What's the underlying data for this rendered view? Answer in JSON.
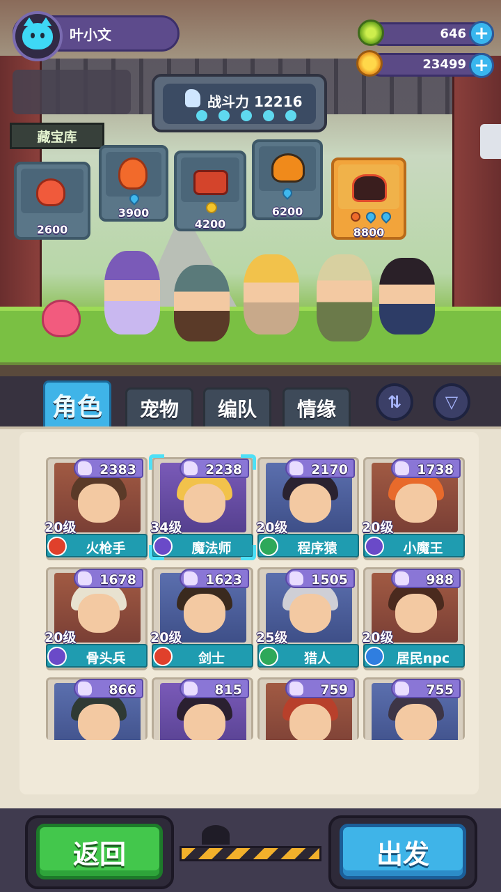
{
  "player": {
    "name": "叶小文"
  },
  "resources": [
    {
      "icon": "green-gem-icon",
      "value": "646"
    },
    {
      "icon": "gold-coin-planet-icon",
      "value": "23499"
    }
  ],
  "power": {
    "label": "战斗力 12216",
    "stars": 5
  },
  "treasure": {
    "label": "藏宝库"
  },
  "pets": [
    {
      "icon": "red-slime-pet",
      "price": "2600",
      "currency": "none"
    },
    {
      "icon": "fire-spirit-pet",
      "price": "3900",
      "currency": "water-drop-icon"
    },
    {
      "icon": "lava-block-pet",
      "price": "4200",
      "currency": "gold-coin-icon"
    },
    {
      "icon": "flame-ghost-pet",
      "price": "6200",
      "currency": "water-drop-icon"
    },
    {
      "icon": "magma-beast-pet",
      "price": "8800",
      "currency": "fire-and-water-icons"
    }
  ],
  "tabs": [
    "角色",
    "宠物",
    "编队",
    "情缘"
  ],
  "active_tab": "角色",
  "characters": [
    {
      "name": "火枪手",
      "level": "20级",
      "power": "2383",
      "class": "red",
      "selected": false
    },
    {
      "name": "魔法师",
      "level": "34级",
      "power": "2238",
      "class": "purple",
      "selected": true
    },
    {
      "name": "程序猿",
      "level": "20级",
      "power": "2170",
      "class": "green",
      "selected": false
    },
    {
      "name": "小魔王",
      "level": "20级",
      "power": "1738",
      "class": "purple",
      "selected": false
    },
    {
      "name": "骨头兵",
      "level": "20级",
      "power": "1678",
      "class": "purple",
      "selected": false
    },
    {
      "name": "剑士",
      "level": "20级",
      "power": "1623",
      "class": "red",
      "selected": false
    },
    {
      "name": "猎人",
      "level": "25级",
      "power": "1505",
      "class": "green",
      "selected": false
    },
    {
      "name": "居民npc",
      "level": "20级",
      "power": "988",
      "class": "blue",
      "selected": false
    },
    {
      "name": "",
      "level": "",
      "power": "866",
      "class": "",
      "selected": false
    },
    {
      "name": "",
      "level": "",
      "power": "815",
      "class": "",
      "selected": false
    },
    {
      "name": "",
      "level": "",
      "power": "759",
      "class": "",
      "selected": false
    },
    {
      "name": "",
      "level": "",
      "power": "755",
      "class": "",
      "selected": false
    }
  ],
  "buttons": {
    "back": "返回",
    "go": "出发"
  },
  "colors": {
    "accent_blue": "#3fb4e8",
    "accent_green": "#43c74c",
    "power_purple": "#8a76d6",
    "name_teal": "#1f9cb0"
  }
}
